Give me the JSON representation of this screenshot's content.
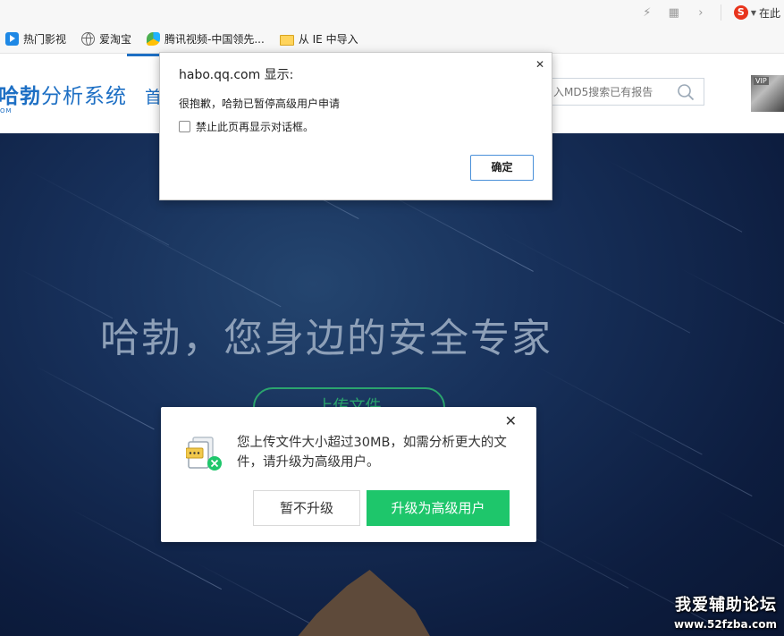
{
  "browser": {
    "right_label": "在此",
    "bookmarks": [
      {
        "label": "热门影视",
        "icon": "play-icon"
      },
      {
        "label": "爱淘宝",
        "icon": "globe-icon"
      },
      {
        "label": "腾讯视频-中国领先...",
        "icon": "tencent-video-icon"
      },
      {
        "label": "从 IE 中导入",
        "icon": "folder-icon"
      }
    ]
  },
  "site": {
    "brand_bold": "哈勃",
    "brand_rest": "分析系统",
    "brand_sub": "OM",
    "nav_first": "首",
    "search_placeholder": "入MD5搜索已有报告",
    "avatar_badge": "VIP"
  },
  "hero": {
    "slogan": "哈勃，您身边的安全专家",
    "upload_label": "上传文件"
  },
  "alert": {
    "title": "habo.qq.com 显示:",
    "message": "很抱歉，哈勃已暂停高级用户申请",
    "checkbox_label": "禁止此页再显示对话框。",
    "ok_label": "确定"
  },
  "modal": {
    "message": "您上传文件大小超过30MB，如需分析更大的文件，请升级为高级用户。",
    "cancel_label": "暂不升级",
    "upgrade_label": "升级为高级用户"
  },
  "watermark": {
    "title": "我爱辅助论坛",
    "url": "www.52fzba.com"
  },
  "colors": {
    "brand_blue": "#1d6fc4",
    "accent_green": "#1ec66b",
    "hero_dark": "#0d1d3f"
  }
}
